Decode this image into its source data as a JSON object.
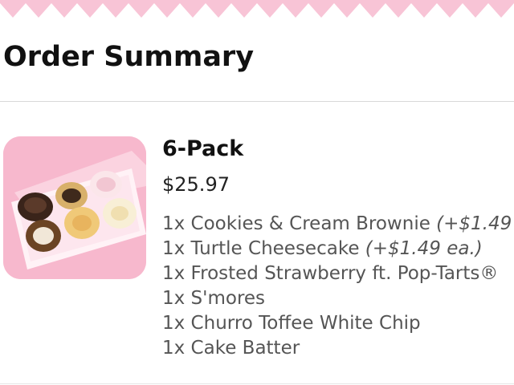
{
  "header": {
    "pattern_color": "#f8c4d6"
  },
  "title": "Order Summary",
  "product": {
    "name": "6-Pack",
    "price": "$25.97",
    "items": [
      {
        "text": "1x Cookies & Cream Brownie",
        "addon": "(+$1.49"
      },
      {
        "text": "1x Turtle Cheesecake",
        "addon": "(+$1.49 ea.)"
      },
      {
        "text": "1x Frosted Strawberry ft. Pop-Tarts®",
        "addon": ""
      },
      {
        "text": "1x S'mores",
        "addon": ""
      },
      {
        "text": "1x Churro Toffee White Chip",
        "addon": ""
      },
      {
        "text": "1x Cake Batter",
        "addon": ""
      }
    ]
  },
  "colors": {
    "accent_pink": "#f7b8cd",
    "text_muted": "#555555"
  }
}
